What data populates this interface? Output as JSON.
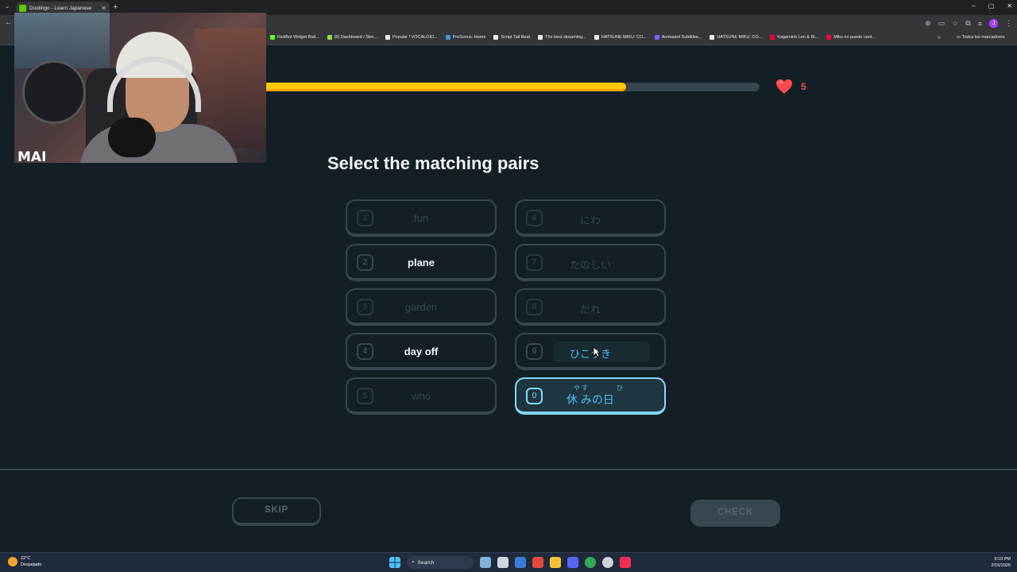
{
  "browser": {
    "tab_title": "Duolingo - Learn Japanese",
    "window_controls": [
      "–",
      "▢",
      "✕"
    ],
    "bookmarks": [
      {
        "label": "KickBot Widget Buil...",
        "color": "#53fc18"
      },
      {
        "label": "(5) Dashboard / Stre...",
        "color": "#9ad94a"
      },
      {
        "label": "Popular ! VOCALOID...",
        "color": "#e8eaed"
      },
      {
        "label": "PreSonus: Home",
        "color": "#4a90d9"
      },
      {
        "label": "Script Tail Beat",
        "color": "#e8eaed"
      },
      {
        "label": "The best streaming...",
        "color": "#e8eaed"
      },
      {
        "label": "HATSUNE MIKU: CO...",
        "color": "#e8eaed"
      },
      {
        "label": "Animated Subtitles...",
        "color": "#7b61ff"
      },
      {
        "label": "HATSUNE MIKU: CO...",
        "color": "#e8eaed"
      },
      {
        "label": "Kagamine Len & Ri...",
        "color": "#ff0033"
      },
      {
        "label": "Miku no puede cant...",
        "color": "#ff0033"
      }
    ],
    "bookmarks_folder": "Todos los marcadores",
    "profile_initial": "J"
  },
  "webcam": {
    "logo_text": "MAI"
  },
  "lesson": {
    "progress": 0.73,
    "hearts": "5",
    "title": "Select the matching pairs",
    "left_pairs": [
      {
        "num": "1",
        "label": "fun",
        "state": "disabled"
      },
      {
        "num": "2",
        "label": "plane",
        "state": "active"
      },
      {
        "num": "3",
        "label": "garden",
        "state": "disabled"
      },
      {
        "num": "4",
        "label": "day off",
        "state": "active"
      },
      {
        "num": "5",
        "label": "who",
        "state": "disabled"
      }
    ],
    "right_pairs": [
      {
        "num": "6",
        "label": "にわ",
        "state": "disabled"
      },
      {
        "num": "7",
        "label": "たのしい",
        "state": "disabled"
      },
      {
        "num": "8",
        "label": "だれ",
        "state": "disabled"
      },
      {
        "num": "9",
        "label": "ひこうき",
        "state": "hover"
      },
      {
        "num": "0",
        "label": "休 みの日",
        "state": "selected",
        "ruby_a": "やす",
        "ruby_b": "ひ"
      }
    ],
    "skip_label": "SKIP",
    "check_label": "CHECK"
  },
  "taskbar": {
    "temperature": "22°C",
    "weather": "Despejado",
    "search_label": "Search",
    "time": "9:10 PM",
    "date": "2/16/2026"
  },
  "colors": {
    "background": "#131f24",
    "progress": "#ffc800",
    "heart": "#ff4b4b",
    "selected_border": "#84d8ff",
    "jp_text": "#49c0f8"
  }
}
